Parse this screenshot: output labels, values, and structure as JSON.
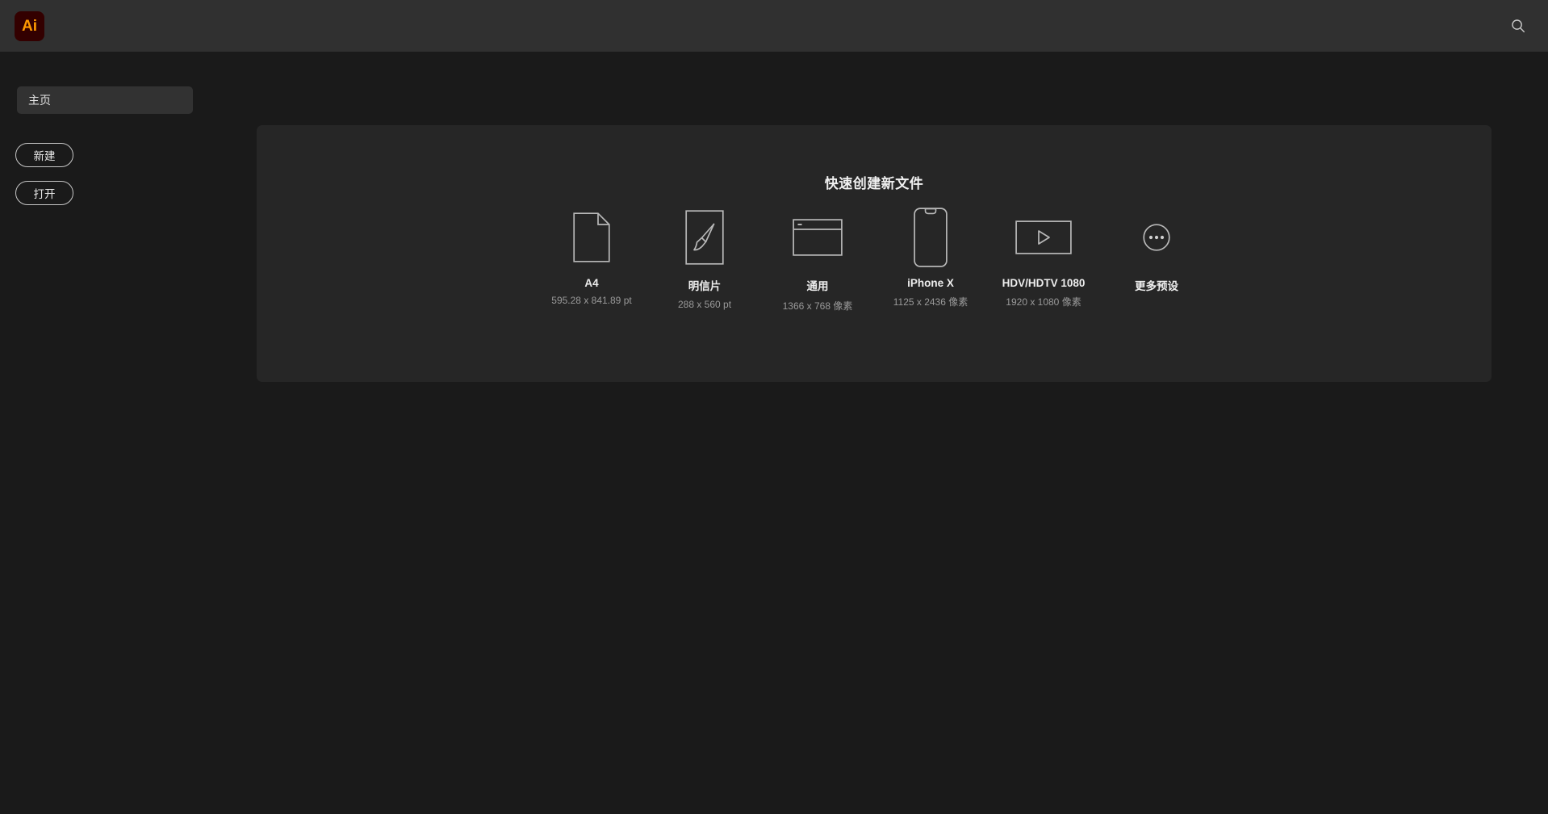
{
  "app": {
    "logo_text": "Ai",
    "logo_bg": "#330000",
    "logo_color": "#ff9a00"
  },
  "header": {
    "search_icon": "search-icon"
  },
  "sidebar": {
    "nav": [
      {
        "label": "主页",
        "name": "home",
        "selected": true
      }
    ],
    "actions": [
      {
        "label": "新建",
        "name": "new"
      },
      {
        "label": "打开",
        "name": "open"
      }
    ]
  },
  "main": {
    "title": "快速创建新文件",
    "presets": [
      {
        "label": "A4",
        "dims": "595.28 x 841.89 pt",
        "icon": "document-icon"
      },
      {
        "label": "明信片",
        "dims": "288 x 560 pt",
        "icon": "brush-icon"
      },
      {
        "label": "通用",
        "dims": "1366 x 768 像素",
        "icon": "browser-window-icon"
      },
      {
        "label": "iPhone X",
        "dims": "1125 x 2436 像素",
        "icon": "phone-icon"
      },
      {
        "label": "HDV/HDTV 1080",
        "dims": "1920 x 1080 像素",
        "icon": "video-play-icon"
      },
      {
        "label": "更多预设",
        "dims": "",
        "icon": "more-ellipsis-icon"
      }
    ]
  },
  "colors": {
    "page_bg": "#1a1a1a",
    "header_bg": "#303030",
    "panel_bg": "#262626",
    "nav_selected_bg": "#323232",
    "icon_stroke": "#b8b8b8",
    "accent": "#ff9a00"
  }
}
